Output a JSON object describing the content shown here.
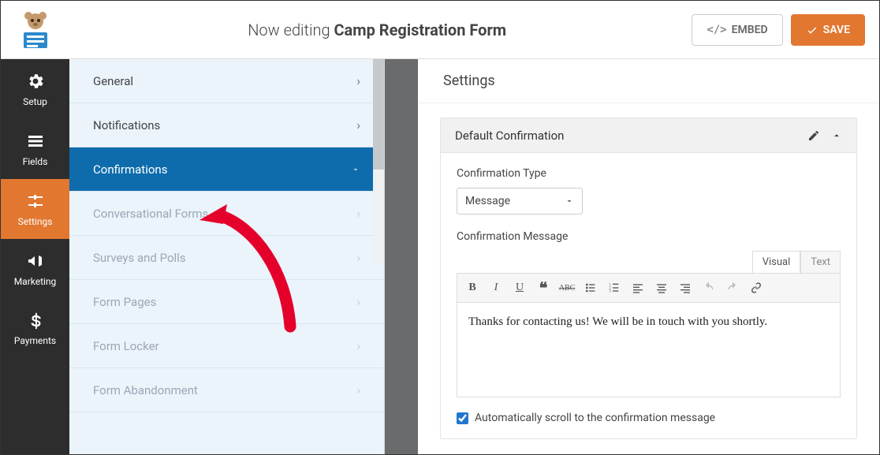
{
  "header": {
    "editing_prefix": "Now editing ",
    "form_name": "Camp Registration Form",
    "embed_label": "EMBED",
    "save_label": "SAVE"
  },
  "nav": {
    "items": [
      {
        "key": "setup",
        "label": "Setup"
      },
      {
        "key": "fields",
        "label": "Fields"
      },
      {
        "key": "settings",
        "label": "Settings"
      },
      {
        "key": "marketing",
        "label": "Marketing"
      },
      {
        "key": "payments",
        "label": "Payments"
      }
    ],
    "active_key": "settings"
  },
  "sidebar": {
    "items": [
      {
        "label": "General",
        "dim": false,
        "expanded": false
      },
      {
        "label": "Notifications",
        "dim": false,
        "expanded": false
      },
      {
        "label": "Confirmations",
        "dim": false,
        "expanded": true,
        "active": true
      },
      {
        "label": "Conversational Forms",
        "dim": true,
        "expanded": false
      },
      {
        "label": "Surveys and Polls",
        "dim": true,
        "expanded": false
      },
      {
        "label": "Form Pages",
        "dim": true,
        "expanded": false
      },
      {
        "label": "Form Locker",
        "dim": true,
        "expanded": false
      },
      {
        "label": "Form Abandonment",
        "dim": true,
        "expanded": false
      }
    ]
  },
  "main": {
    "section_title": "Settings",
    "panel_title": "Default Confirmation",
    "confirmation_type_label": "Confirmation Type",
    "confirmation_type_value": "Message",
    "confirmation_message_label": "Confirmation Message",
    "editor_tabs": {
      "visual": "Visual",
      "text": "Text",
      "active": "visual"
    },
    "message_text": "Thanks for contacting us! We will be in touch with you shortly.",
    "autoscroll_label": "Automatically scroll to the confirmation message",
    "autoscroll_checked": true
  },
  "colors": {
    "accent": "#e27730",
    "sidebar_active": "#0e6cad",
    "nav_bg": "#2d2d2d"
  }
}
